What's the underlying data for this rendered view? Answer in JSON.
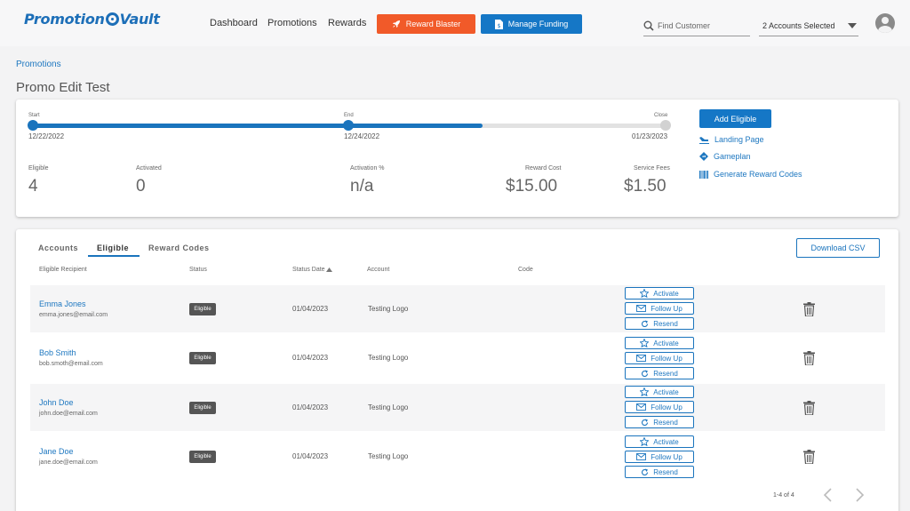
{
  "app": {
    "logo_text_a": "Promotion",
    "logo_text_b": "Vault"
  },
  "nav": {
    "links": [
      "Dashboard",
      "Promotions",
      "Rewards"
    ],
    "reward_blaster": "Reward Blaster",
    "manage_funding": "Manage Funding",
    "find_placeholder": "Find Customer",
    "accounts_selected": "2 Accounts Selected"
  },
  "breadcrumb": "Promotions",
  "page_title": "Promo Edit Test",
  "timeline": {
    "start_label": "Start",
    "start_date": "12/22/2022",
    "end_label": "End",
    "end_date": "12/24/2022",
    "close_label": "Close",
    "close_date": "01/23/2023",
    "progress_fraction": 0.71
  },
  "stats": [
    {
      "label": "Eligible",
      "value": "4"
    },
    {
      "label": "Activated",
      "value": "0"
    },
    {
      "label": "Activation %",
      "value": "n/a"
    },
    {
      "label": "Reward Cost",
      "value": "$15.00"
    },
    {
      "label": "Service Fees",
      "value": "$1.50"
    }
  ],
  "actions": {
    "add_eligible": "Add Eligible",
    "landing_page": "Landing Page",
    "gameplan": "Gameplan",
    "generate_codes": "Generate Reward Codes"
  },
  "tabs": [
    "Accounts",
    "Eligible",
    "Reward Codes"
  ],
  "active_tab": "Eligible",
  "download_csv": "Download CSV",
  "columns": [
    "Eligible Recipient",
    "Status",
    "Status Date",
    "Account",
    "Code"
  ],
  "row_buttons": {
    "activate": "Activate",
    "follow_up": "Follow Up",
    "resend": "Resend"
  },
  "rows": [
    {
      "name": "Emma Jones",
      "email": "emma.jones@email.com",
      "status": "Eligible",
      "date": "01/04/2023",
      "account": "Testing Logo"
    },
    {
      "name": "Bob Smith",
      "email": "bob.smoth@email.com",
      "status": "Eligible",
      "date": "01/04/2023",
      "account": "Testing Logo"
    },
    {
      "name": "John Doe",
      "email": "john.doe@email.com",
      "status": "Eligible",
      "date": "01/04/2023",
      "account": "Testing Logo"
    },
    {
      "name": "Jane Doe",
      "email": "jane.doe@email.com",
      "status": "Eligible",
      "date": "01/04/2023",
      "account": "Testing Logo"
    }
  ],
  "pagination": "1-4 of 4",
  "colors": {
    "primary": "#1577c6",
    "accent_orange": "#f15a29",
    "link": "#1d77c0"
  }
}
